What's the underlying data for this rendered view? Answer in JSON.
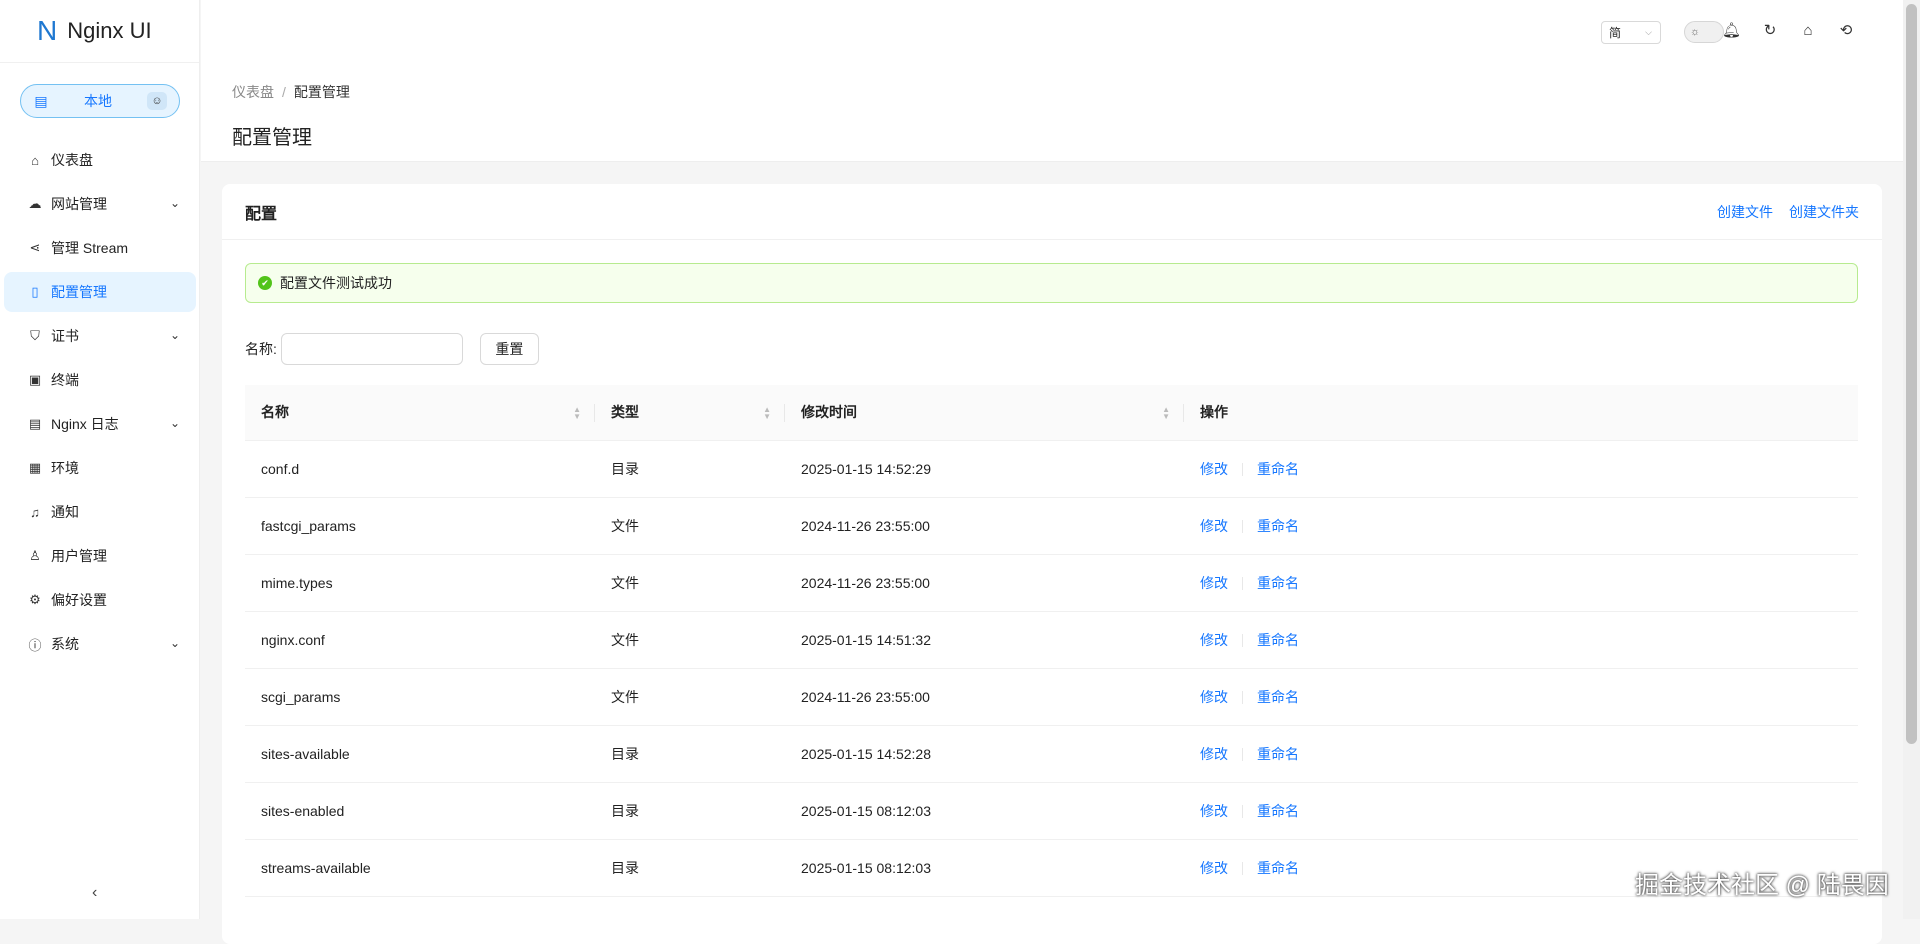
{
  "app": {
    "logo_mark": "N",
    "title": "Nginx UI"
  },
  "env": {
    "icon": "server-icon",
    "label": "本地",
    "badge_icon": "robot-icon"
  },
  "sidebar": {
    "items": [
      {
        "label": "仪表盘",
        "icon": "home-icon",
        "glyph": "⌂"
      },
      {
        "label": "网站管理",
        "icon": "cloud-icon",
        "glyph": "☁",
        "expand": true
      },
      {
        "label": "管理 Stream",
        "icon": "share-icon",
        "glyph": "⋖"
      },
      {
        "label": "配置管理",
        "icon": "file-icon",
        "glyph": "▯",
        "active": true
      },
      {
        "label": "证书",
        "icon": "shield-icon",
        "glyph": "⛉",
        "expand": true
      },
      {
        "label": "终端",
        "icon": "terminal-icon",
        "glyph": "▣"
      },
      {
        "label": "Nginx 日志",
        "icon": "file-text-icon",
        "glyph": "▤",
        "expand": true
      },
      {
        "label": "环境",
        "icon": "database-icon",
        "glyph": "▦"
      },
      {
        "label": "通知",
        "icon": "bell-icon",
        "glyph": "♫"
      },
      {
        "label": "用户管理",
        "icon": "user-icon",
        "glyph": "♙"
      },
      {
        "label": "偏好设置",
        "icon": "gear-icon",
        "glyph": "⚙"
      },
      {
        "label": "系统",
        "icon": "info-icon",
        "glyph": "ⓘ",
        "expand": true
      }
    ],
    "collapse_glyph": "‹"
  },
  "header": {
    "lang": "简"
  },
  "breadcrumb": {
    "root": "仪表盘",
    "separator": "/",
    "current": "配置管理"
  },
  "page_title": "配置管理",
  "card": {
    "title": "配置",
    "create_file": "创建文件",
    "create_folder": "创建文件夹",
    "alert": "配置文件测试成功"
  },
  "filter": {
    "label": "名称:",
    "value": "",
    "reset": "重置"
  },
  "table": {
    "headers": [
      "名称",
      "类型",
      "修改时间",
      "操作"
    ],
    "action_edit": "修改",
    "action_rename": "重命名",
    "rows": [
      {
        "name": "conf.d",
        "type": "目录",
        "time": "2025-01-15 14:52:29"
      },
      {
        "name": "fastcgi_params",
        "type": "文件",
        "time": "2024-11-26 23:55:00"
      },
      {
        "name": "mime.types",
        "type": "文件",
        "time": "2024-11-26 23:55:00"
      },
      {
        "name": "nginx.conf",
        "type": "文件",
        "time": "2025-01-15 14:51:32"
      },
      {
        "name": "scgi_params",
        "type": "文件",
        "time": "2024-11-26 23:55:00"
      },
      {
        "name": "sites-available",
        "type": "目录",
        "time": "2025-01-15 14:52:28"
      },
      {
        "name": "sites-enabled",
        "type": "目录",
        "time": "2025-01-15 08:12:03"
      },
      {
        "name": "streams-available",
        "type": "目录",
        "time": "2025-01-15 08:12:03"
      }
    ]
  },
  "watermark": "掘金技术社区 @ 陆畏因"
}
